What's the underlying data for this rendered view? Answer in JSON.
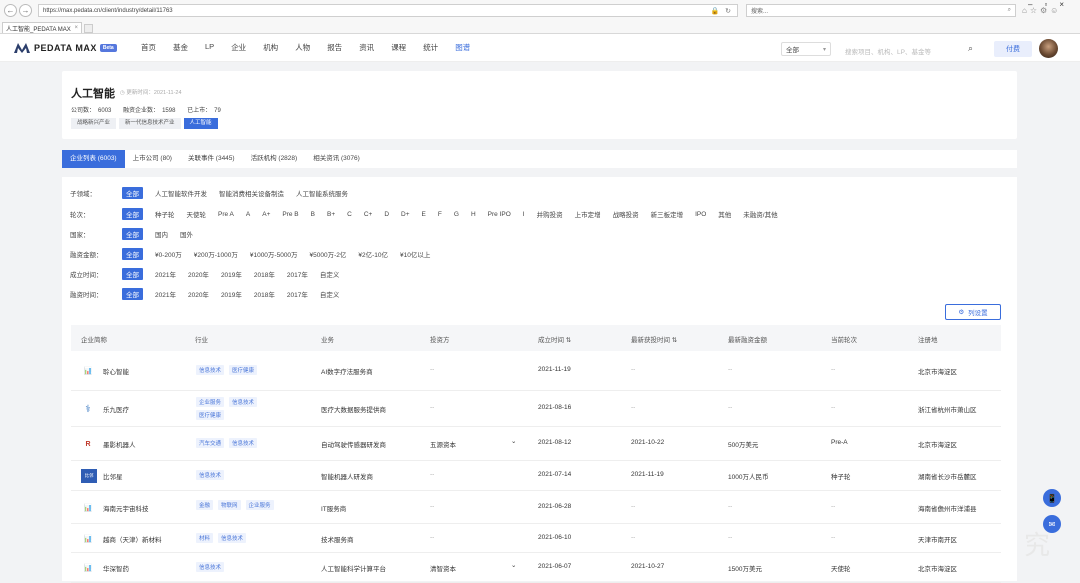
{
  "browser": {
    "url": "https://max.pedata.cn/client/industry/detail/11763",
    "search_placeholder": "搜索...",
    "tab_title": "人工智能_PEDATA MAX"
  },
  "header": {
    "logo_text": "PEDATA MAX",
    "beta": "Beta",
    "nav": [
      "首页",
      "基金",
      "LP",
      "企业",
      "机构",
      "人物",
      "报告",
      "资讯",
      "课程",
      "统计",
      "图谱"
    ],
    "nav_active_index": 10,
    "select_label": "全部",
    "search_placeholder": "搜索项目、机构、LP、基金等",
    "pay_label": "付费"
  },
  "industry": {
    "title": "人工智能",
    "update_label": "更新时间：2021-11-24",
    "company_count_label": "公司数：",
    "company_count": "6003",
    "financing_count_label": "融资企业数：",
    "financing_count": "1598",
    "listed_label": "已上市：",
    "listed_count": "79",
    "chain": [
      "战略新兴产业",
      "新一代信息技术产业",
      "人工智能"
    ]
  },
  "tabs": [
    "企业列表 (6003)",
    "上市公司 (80)",
    "关联事件 (3445)",
    "活跃机构 (2828)",
    "相关资讯 (3076)"
  ],
  "filters": [
    {
      "label": "子领域：",
      "options": [
        "全部",
        "人工智能软件开发",
        "智能消费相关设备制造",
        "人工智能系统服务"
      ]
    },
    {
      "label": "轮次：",
      "options": [
        "全部",
        "种子轮",
        "天使轮",
        "Pre A",
        "A",
        "A+",
        "Pre B",
        "B",
        "B+",
        "C",
        "C+",
        "D",
        "D+",
        "E",
        "F",
        "G",
        "H",
        "Pre IPO",
        "I",
        "并购投资",
        "上市定增",
        "战略投资",
        "新三板定增",
        "IPO",
        "其他",
        "未融资/其他"
      ]
    },
    {
      "label": "国家：",
      "options": [
        "全部",
        "国内",
        "国外"
      ]
    },
    {
      "label": "融资金额：",
      "options": [
        "全部",
        "¥0-200万",
        "¥200万-1000万",
        "¥1000万-5000万",
        "¥5000万-2亿",
        "¥2亿-10亿",
        "¥10亿以上"
      ]
    },
    {
      "label": "成立时间：",
      "options": [
        "全部",
        "2021年",
        "2020年",
        "2019年",
        "2018年",
        "2017年",
        "自定义"
      ]
    },
    {
      "label": "融资时间：",
      "options": [
        "全部",
        "2021年",
        "2020年",
        "2019年",
        "2018年",
        "2017年",
        "自定义"
      ]
    }
  ],
  "column_settings_label": "列设置",
  "table": {
    "headers": [
      "企业简称",
      "行业",
      "业务",
      "投资方",
      "成立时间 ⇅",
      "最新获投时间 ⇅",
      "最新融资金额",
      "当前轮次",
      "注册地"
    ],
    "rows": [
      {
        "name": "聆心智能",
        "tags": [
          "信息技术",
          "医疗健康"
        ],
        "business": "AI数字疗法服务商",
        "investor": "--",
        "founded": "2021-11-19",
        "latest": "--",
        "amount": "--",
        "round": "--",
        "location": "北京市海淀区",
        "icon": "chart"
      },
      {
        "name": "乐九医疗",
        "tags": [
          "企业服务",
          "信息技术",
          "医疗健康"
        ],
        "business": "医疗大数据服务提供商",
        "investor": "--",
        "founded": "2021-08-16",
        "latest": "--",
        "amount": "--",
        "round": "--",
        "location": "浙江省杭州市萧山区",
        "icon": "lejiu"
      },
      {
        "name": "墨影机器人",
        "tags": [
          "汽车交通",
          "信息技术"
        ],
        "business": "自动驾驶传感器研发商",
        "investor": "五源资本",
        "founded": "2021-08-12",
        "latest": "2021-10-22",
        "amount": "500万美元",
        "round": "Pre-A",
        "location": "北京市海淀区",
        "icon": "moying"
      },
      {
        "name": "比邻星",
        "tags": [
          "信息技术"
        ],
        "business": "智能机器人研发商",
        "investor": "--",
        "founded": "2021-07-14",
        "latest": "2021-11-19",
        "amount": "1000万人民币",
        "round": "种子轮",
        "location": "湖南省长沙市岳麓区",
        "icon": "bilinxing"
      },
      {
        "name": "海南元宇宙科技",
        "tags": [
          "金融",
          "物联网",
          "企业服务"
        ],
        "business": "IT服务商",
        "investor": "--",
        "founded": "2021-06-28",
        "latest": "--",
        "amount": "--",
        "round": "--",
        "location": "海南省儋州市洋浦县",
        "icon": "chart"
      },
      {
        "name": "越商（天津）新材料",
        "tags": [
          "材料",
          "信息技术"
        ],
        "business": "技术服务商",
        "investor": "--",
        "founded": "2021-06-10",
        "latest": "--",
        "amount": "--",
        "round": "--",
        "location": "天津市南开区",
        "icon": "chart"
      },
      {
        "name": "华深智药",
        "tags": [
          "信息技术"
        ],
        "business": "人工智能科学计算平台",
        "investor": "清智资本",
        "founded": "2021-06-07",
        "latest": "2021-10-27",
        "amount": "1500万美元",
        "round": "天使轮",
        "location": "北京市海淀区",
        "icon": "chart"
      }
    ]
  },
  "colors": {
    "accent": "#3a6ddc",
    "tag_bg": "#edf2fd"
  }
}
